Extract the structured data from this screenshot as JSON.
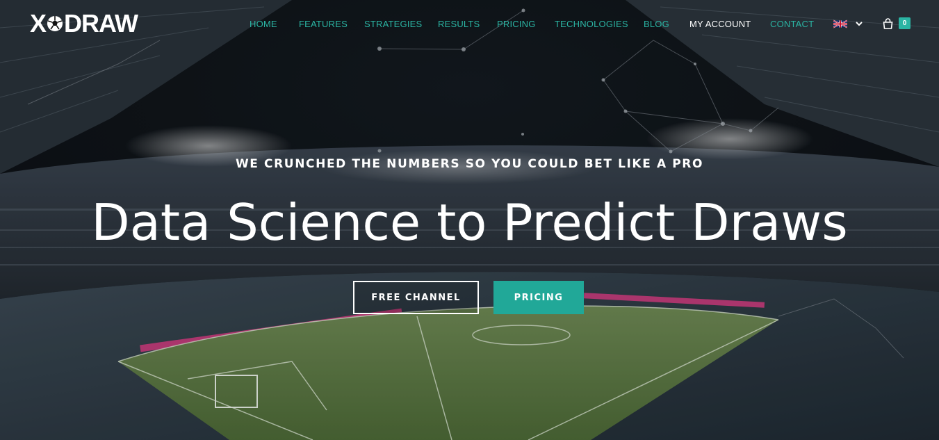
{
  "brand": {
    "logo_left": "X",
    "logo_right": "DRAW"
  },
  "nav": {
    "items": [
      {
        "label": "HOME"
      },
      {
        "label": "FEATURES"
      },
      {
        "label": "STRATEGIES"
      },
      {
        "label": "RESULTS"
      },
      {
        "label": "PRICING"
      },
      {
        "label": "TECHNOLOGIES"
      },
      {
        "label": "BLOG"
      },
      {
        "label": "MY ACCOUNT",
        "active": true
      },
      {
        "label": "CONTACT"
      }
    ],
    "language_icon": "uk-flag-icon",
    "cart_icon": "shopping-bag-icon",
    "cart_count": "0"
  },
  "hero": {
    "kicker": "WE CRUNCHED THE NUMBERS SO YOU COULD BET LIKE A PRO",
    "headline": "Data Science to Predict Draws",
    "buttons": {
      "free_channel": "FREE CHANNEL",
      "pricing": "PRICING"
    }
  },
  "colors": {
    "accent": "#2bb5a4",
    "button_fill": "#21a898",
    "active_nav": "#ffffff"
  }
}
